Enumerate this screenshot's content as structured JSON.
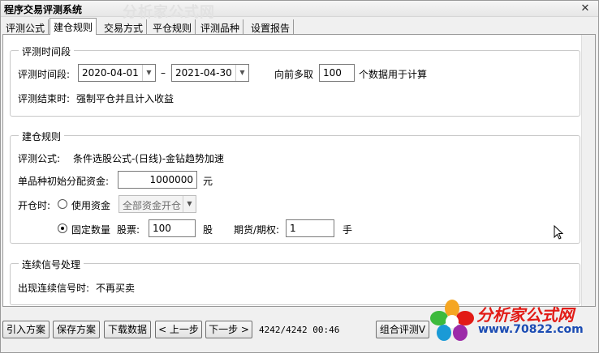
{
  "window": {
    "title": "程序交易评测系统",
    "watermark": "分析家公式网",
    "close_glyph": "✕"
  },
  "tabs": [
    "评测公式",
    "建仓规则",
    "交易方式",
    "平仓规则",
    "评测品种",
    "设置报告"
  ],
  "active_tab": "建仓规则",
  "section_period": {
    "legend": "评测时间段",
    "label": "评测时间段:",
    "start_date": "2020-04-01",
    "dash": "–",
    "end_date": "2021-04-30",
    "lookback_prefix": "向前多取",
    "lookback_value": "100",
    "lookback_suffix": "个数据用于计算",
    "end_label": "评测结束时:",
    "end_value": "强制平仓并且计入收益"
  },
  "section_open": {
    "legend": "建仓规则",
    "formula_label": "评测公式:",
    "formula_value": "条件选股公式-(日线)-金钻趋势加速",
    "capital_label": "单品种初始分配资金:",
    "capital_value": "1000000",
    "capital_unit": "元",
    "open_label": "开仓时:",
    "use_funds_label": "使用资金",
    "use_funds_option": "全部资金开仓",
    "fixed_qty_label": "固定数量",
    "stock_label": "股票:",
    "stock_value": "100",
    "stock_unit": "股",
    "futures_label": "期货/期权:",
    "futures_value": "1",
    "futures_unit": "手",
    "selected_mode": "固定数量"
  },
  "section_signal": {
    "legend": "连续信号处理",
    "label": "出现连续信号时:",
    "value": "不再买卖"
  },
  "bottom": {
    "import_btn": "引入方案",
    "save_btn": "保存方案",
    "download_btn": "下载数据",
    "prev_btn": "< 上一步",
    "next_btn": "下一步 >",
    "status": "4242/4242 00:46",
    "combo_btn": "组合评测V"
  },
  "logo": {
    "text": "分析家公式网",
    "url": "www.70822.com"
  },
  "colors": {
    "logo_red": "#e21b16",
    "logo_blue": "#1a4bb3"
  }
}
